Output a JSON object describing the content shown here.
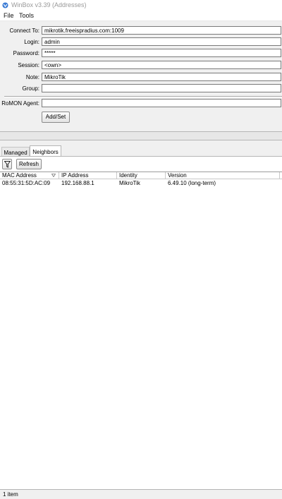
{
  "window": {
    "title": "WinBox v3.39 (Addresses)"
  },
  "menu": {
    "items": [
      "File",
      "Tools"
    ]
  },
  "form": {
    "connect_to": {
      "label": "Connect To:",
      "value": "mikrotik.freeispradius.com:1009"
    },
    "login": {
      "label": "Login:",
      "value": "admin"
    },
    "password": {
      "label": "Password:",
      "value": "*****"
    },
    "session": {
      "label": "Session:",
      "value": "<own>"
    },
    "note": {
      "label": "Note:",
      "value": "MikroTik"
    },
    "group": {
      "label": "Group:",
      "value": ""
    },
    "romon_agent": {
      "label": "RoMON Agent:",
      "value": ""
    },
    "add_set_label": "Add/Set"
  },
  "tabs": [
    {
      "label": "Managed",
      "active": false
    },
    {
      "label": "Neighbors",
      "active": true
    }
  ],
  "toolbar": {
    "filter_icon": "filter-icon",
    "refresh_label": "Refresh"
  },
  "table": {
    "columns": [
      "MAC Address",
      "IP Address",
      "Identity",
      "Version"
    ],
    "rows": [
      {
        "mac": "08:55:31:5D:AC:09",
        "ip": "192.168.88.1",
        "identity": "MikroTik",
        "version": "6.49.10 (long-term)"
      }
    ]
  },
  "status": {
    "text": "1 item"
  },
  "colors": {
    "app_icon": "#3a7bd5",
    "title_text": "#999999"
  }
}
